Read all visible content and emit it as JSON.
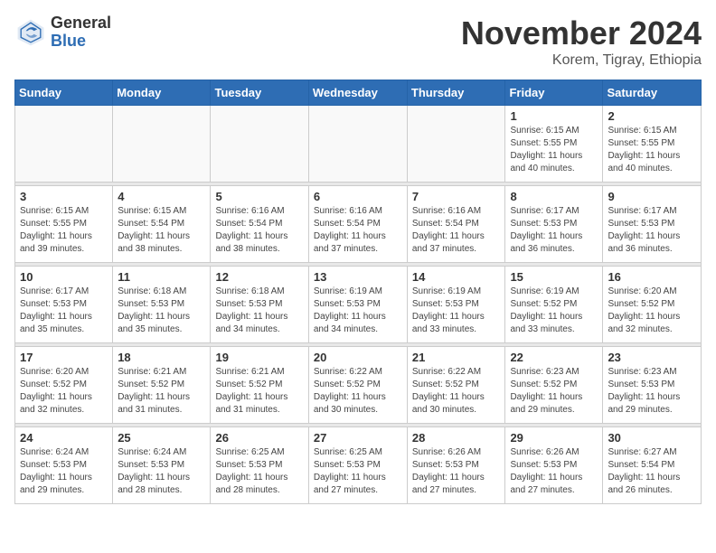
{
  "logo": {
    "general": "General",
    "blue": "Blue"
  },
  "header": {
    "month": "November 2024",
    "location": "Korem, Tigray, Ethiopia"
  },
  "days_of_week": [
    "Sunday",
    "Monday",
    "Tuesday",
    "Wednesday",
    "Thursday",
    "Friday",
    "Saturday"
  ],
  "weeks": [
    [
      {
        "day": "",
        "info": ""
      },
      {
        "day": "",
        "info": ""
      },
      {
        "day": "",
        "info": ""
      },
      {
        "day": "",
        "info": ""
      },
      {
        "day": "",
        "info": ""
      },
      {
        "day": "1",
        "info": "Sunrise: 6:15 AM\nSunset: 5:55 PM\nDaylight: 11 hours and 40 minutes."
      },
      {
        "day": "2",
        "info": "Sunrise: 6:15 AM\nSunset: 5:55 PM\nDaylight: 11 hours and 40 minutes."
      }
    ],
    [
      {
        "day": "3",
        "info": "Sunrise: 6:15 AM\nSunset: 5:55 PM\nDaylight: 11 hours and 39 minutes."
      },
      {
        "day": "4",
        "info": "Sunrise: 6:15 AM\nSunset: 5:54 PM\nDaylight: 11 hours and 38 minutes."
      },
      {
        "day": "5",
        "info": "Sunrise: 6:16 AM\nSunset: 5:54 PM\nDaylight: 11 hours and 38 minutes."
      },
      {
        "day": "6",
        "info": "Sunrise: 6:16 AM\nSunset: 5:54 PM\nDaylight: 11 hours and 37 minutes."
      },
      {
        "day": "7",
        "info": "Sunrise: 6:16 AM\nSunset: 5:54 PM\nDaylight: 11 hours and 37 minutes."
      },
      {
        "day": "8",
        "info": "Sunrise: 6:17 AM\nSunset: 5:53 PM\nDaylight: 11 hours and 36 minutes."
      },
      {
        "day": "9",
        "info": "Sunrise: 6:17 AM\nSunset: 5:53 PM\nDaylight: 11 hours and 36 minutes."
      }
    ],
    [
      {
        "day": "10",
        "info": "Sunrise: 6:17 AM\nSunset: 5:53 PM\nDaylight: 11 hours and 35 minutes."
      },
      {
        "day": "11",
        "info": "Sunrise: 6:18 AM\nSunset: 5:53 PM\nDaylight: 11 hours and 35 minutes."
      },
      {
        "day": "12",
        "info": "Sunrise: 6:18 AM\nSunset: 5:53 PM\nDaylight: 11 hours and 34 minutes."
      },
      {
        "day": "13",
        "info": "Sunrise: 6:19 AM\nSunset: 5:53 PM\nDaylight: 11 hours and 34 minutes."
      },
      {
        "day": "14",
        "info": "Sunrise: 6:19 AM\nSunset: 5:53 PM\nDaylight: 11 hours and 33 minutes."
      },
      {
        "day": "15",
        "info": "Sunrise: 6:19 AM\nSunset: 5:52 PM\nDaylight: 11 hours and 33 minutes."
      },
      {
        "day": "16",
        "info": "Sunrise: 6:20 AM\nSunset: 5:52 PM\nDaylight: 11 hours and 32 minutes."
      }
    ],
    [
      {
        "day": "17",
        "info": "Sunrise: 6:20 AM\nSunset: 5:52 PM\nDaylight: 11 hours and 32 minutes."
      },
      {
        "day": "18",
        "info": "Sunrise: 6:21 AM\nSunset: 5:52 PM\nDaylight: 11 hours and 31 minutes."
      },
      {
        "day": "19",
        "info": "Sunrise: 6:21 AM\nSunset: 5:52 PM\nDaylight: 11 hours and 31 minutes."
      },
      {
        "day": "20",
        "info": "Sunrise: 6:22 AM\nSunset: 5:52 PM\nDaylight: 11 hours and 30 minutes."
      },
      {
        "day": "21",
        "info": "Sunrise: 6:22 AM\nSunset: 5:52 PM\nDaylight: 11 hours and 30 minutes."
      },
      {
        "day": "22",
        "info": "Sunrise: 6:23 AM\nSunset: 5:52 PM\nDaylight: 11 hours and 29 minutes."
      },
      {
        "day": "23",
        "info": "Sunrise: 6:23 AM\nSunset: 5:53 PM\nDaylight: 11 hours and 29 minutes."
      }
    ],
    [
      {
        "day": "24",
        "info": "Sunrise: 6:24 AM\nSunset: 5:53 PM\nDaylight: 11 hours and 29 minutes."
      },
      {
        "day": "25",
        "info": "Sunrise: 6:24 AM\nSunset: 5:53 PM\nDaylight: 11 hours and 28 minutes."
      },
      {
        "day": "26",
        "info": "Sunrise: 6:25 AM\nSunset: 5:53 PM\nDaylight: 11 hours and 28 minutes."
      },
      {
        "day": "27",
        "info": "Sunrise: 6:25 AM\nSunset: 5:53 PM\nDaylight: 11 hours and 27 minutes."
      },
      {
        "day": "28",
        "info": "Sunrise: 6:26 AM\nSunset: 5:53 PM\nDaylight: 11 hours and 27 minutes."
      },
      {
        "day": "29",
        "info": "Sunrise: 6:26 AM\nSunset: 5:53 PM\nDaylight: 11 hours and 27 minutes."
      },
      {
        "day": "30",
        "info": "Sunrise: 6:27 AM\nSunset: 5:54 PM\nDaylight: 11 hours and 26 minutes."
      }
    ]
  ]
}
